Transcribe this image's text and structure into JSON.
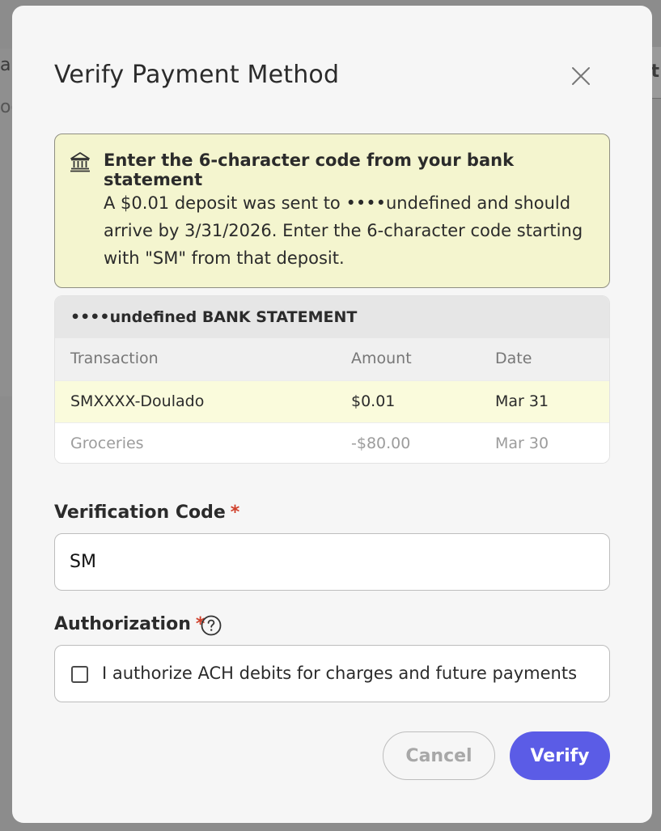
{
  "background": {
    "left_peek_a": "a",
    "left_peek_b": "og",
    "right_peek": "it"
  },
  "modal": {
    "title": "Verify Payment Method",
    "close_icon": "close-icon"
  },
  "notice": {
    "icon": "bank-icon",
    "heading": "Enter the 6-character code from your bank statement",
    "body": "A $0.01 deposit was sent to ••••undefined and should arrive by 3/31/2026. Enter the 6-character code starting with \"SM\" from that deposit."
  },
  "statement": {
    "title": "••••undefined BANK STATEMENT",
    "columns": [
      "Transaction",
      "Amount",
      "Date"
    ],
    "rows": [
      {
        "transaction": "SMXXXX-Doulado",
        "amount": "$0.01",
        "date": "Mar 31"
      },
      {
        "transaction": "Groceries",
        "amount": "-$80.00",
        "date": "Mar 30"
      }
    ]
  },
  "verification": {
    "label": "Verification Code",
    "required_mark": "*",
    "value": "SM"
  },
  "authorization": {
    "label": "Authorization",
    "required_mark": "*",
    "help_icon": "help-icon",
    "checkbox_label": "I authorize ACH debits for charges and future payments",
    "checked": false
  },
  "actions": {
    "cancel_label": "Cancel",
    "verify_label": "Verify"
  },
  "colors": {
    "accent": "#5b5ce6",
    "notice_bg": "#f4f5cf",
    "required": "#d0402b"
  }
}
